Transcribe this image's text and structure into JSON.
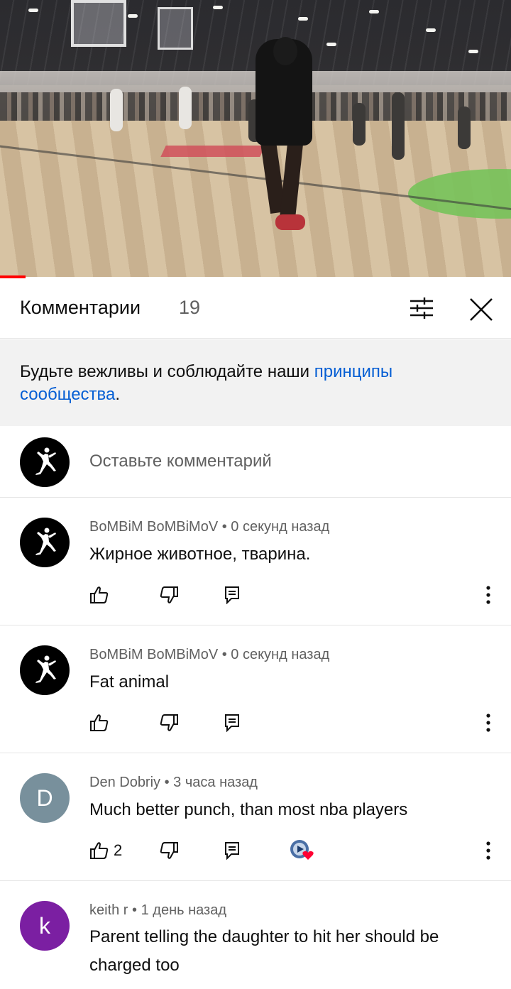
{
  "video": {
    "progress_fraction": 0.05
  },
  "comments_header": {
    "title": "Комментарии",
    "count": "19"
  },
  "guidelines": {
    "text": "Будьте вежливы и соблюдайте наши ",
    "link": "принципы сообщества",
    "end": "."
  },
  "composer": {
    "placeholder": "Оставьте комментарий"
  },
  "comments": [
    {
      "author": "BoMBiM BoMBiMoV",
      "time": "0 секунд назад",
      "text": "Жирное животное, тварина.",
      "likes": "",
      "avatar": "jordan-logo"
    },
    {
      "author": "BoMBiM BoMBiMoV",
      "time": "0 секунд назад",
      "text": "Fat animal",
      "likes": "",
      "avatar": "jordan-logo"
    },
    {
      "author": "Den Dobriy",
      "time": "3 часа назад",
      "text": "Much better punch, than most nba players",
      "likes": "2",
      "avatar_letter": "D",
      "avatar_color": "#78909c",
      "creator_heart": true
    },
    {
      "author": "keith r",
      "time": "1 день назад",
      "text": "Parent telling the daughter to hit her should be charged too",
      "avatar_letter": "k",
      "avatar_color": "#7b1fa2"
    }
  ],
  "separator": " • ",
  "colors": {
    "link": "#065fd4",
    "progress": "#ff0000",
    "secondary_text": "#606060",
    "heart": "#ff0033"
  }
}
